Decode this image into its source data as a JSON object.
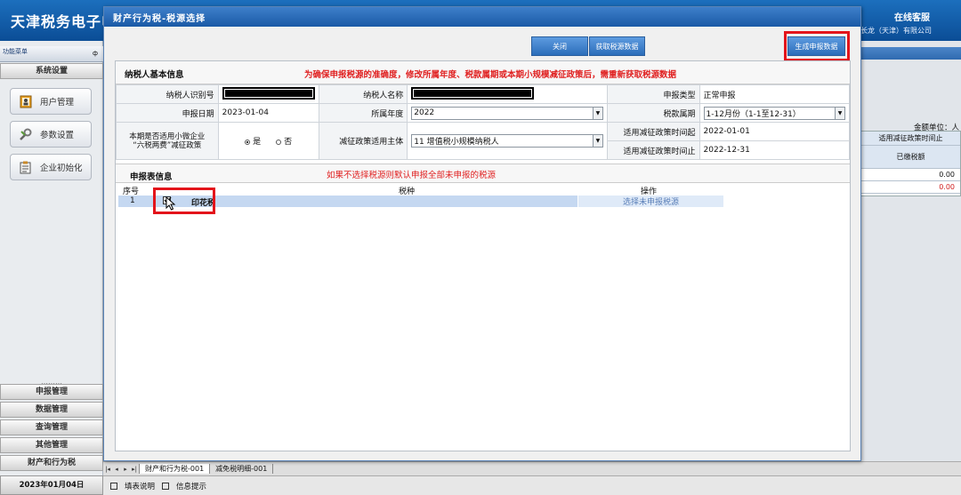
{
  "app": {
    "title": "天津税务电子申",
    "online_service": "在线客服",
    "company": "长龙（天津）有限公司"
  },
  "sidebar": {
    "menu_header": "功能菜单",
    "pin": "ф",
    "settings_title": "系统设置",
    "buttons": [
      {
        "label": "用户管理",
        "icon": "user-book-icon"
      },
      {
        "label": "参数设置",
        "icon": "wrench-icon"
      },
      {
        "label": "企业初始化",
        "icon": "clipboard-icon"
      }
    ],
    "dots": "………",
    "sections": [
      "申报管理",
      "数据管理",
      "查询管理",
      "其他管理",
      "财产和行为税"
    ],
    "date": "2023年01月04日"
  },
  "background": {
    "amount_unit": "金额单位：人",
    "col_header": "适用减征政策时间止",
    "col_sub": "已缴税额",
    "values": [
      "0.00",
      "0.00"
    ]
  },
  "dialog": {
    "title": "财产行为税-税源选择",
    "buttons": {
      "close": "关闭",
      "fetch": "获取税源数据",
      "generate": "生成申报数据"
    },
    "section1_title": "纳税人基本信息",
    "notice": "为确保申报税源的准确度，修改所属年度、税款属期或本期小规模减征政策后，需重新获取税源数据",
    "fields": {
      "taxpayer_id_label": "纳税人识别号",
      "taxpayer_name_label": "纳税人名称",
      "declare_type_label": "申报类型",
      "declare_type_value": "正常申报",
      "declare_date_label": "申报日期",
      "declare_date_value": "2023-01-04",
      "year_label": "所属年度",
      "year_value": "2022",
      "period_label": "税款属期",
      "period_value": "1-12月份（1-1至12-31）",
      "small_policy_label_1": "本期是否适用小微企业",
      "small_policy_label_2": "“六税两费”减征政策",
      "yes": "是",
      "no": "否",
      "subject_label": "减征政策适用主体",
      "subject_value": "11 增值税小规模纳税人",
      "policy_start_label": "适用减征政策时间起",
      "policy_start_value": "2022-01-01",
      "policy_end_label": "适用减征政策时间止",
      "policy_end_value": "2022-12-31"
    },
    "section2_title": "申报表信息",
    "hint2": "如果不选择税源则默认申报全部未申报的税源",
    "table": {
      "headers": [
        "序号",
        "税种",
        "操作"
      ],
      "rows": [
        {
          "no": "1",
          "tax": "印花税",
          "action": "选择未申报税源",
          "checked": true
        }
      ]
    }
  },
  "sheet_tabs": [
    "财产和行为税-001",
    "减免税明细-001"
  ],
  "statusbar": {
    "fill_guide": "填表说明",
    "info_tips": "信息提示"
  },
  "colors": {
    "title_blue": "#1a5aa6",
    "highlight_red": "#e3141b",
    "notice_red": "#e02020",
    "selected_row": "#c5d8f1"
  }
}
